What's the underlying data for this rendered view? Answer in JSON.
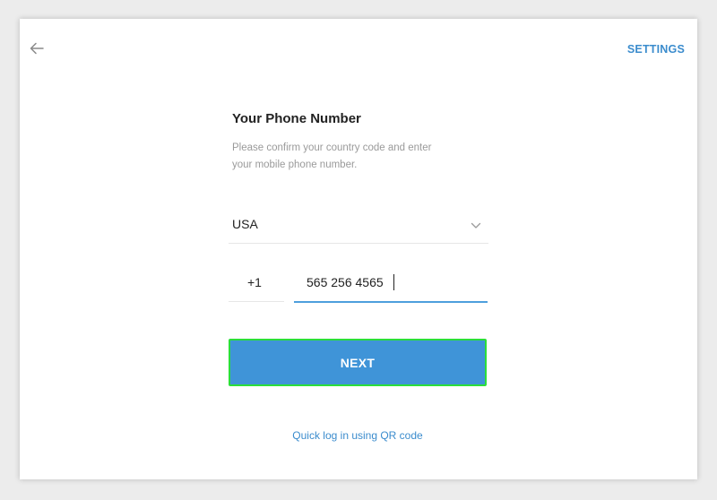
{
  "header": {
    "back_icon": "arrow-left-icon",
    "settings_label": "SETTINGS"
  },
  "form": {
    "title": "Your Phone Number",
    "subtitle": "Please confirm your country code and enter your mobile phone number.",
    "country": {
      "selected": "USA",
      "icon": "chevron-down-icon"
    },
    "country_code": "+1",
    "phone_number": "565 256 4565",
    "next_label": "NEXT",
    "qr_link_label": "Quick log in using QR code"
  },
  "colors": {
    "accent": "#3f94d8",
    "link": "#3b8ccd",
    "focus_outline": "#2bde3a",
    "active_underline": "#4e9fdd"
  }
}
